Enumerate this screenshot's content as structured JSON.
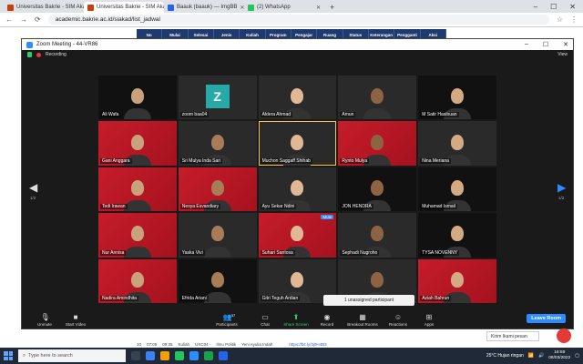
{
  "browser": {
    "tabs": [
      {
        "title": "Universitas Bakrie - SIM Akadem",
        "color": "#c2410c",
        "active": false
      },
      {
        "title": "Universitas Bakrie - SIM Akadem",
        "color": "#c2410c",
        "active": true
      },
      {
        "title": "Baauk (baauk) — ImgBB",
        "color": "#2563eb",
        "active": false
      },
      {
        "title": "(2) WhatsApp",
        "color": "#22c55e",
        "active": false
      }
    ],
    "new_tab": "+",
    "url": "academic.bakrie.ac.id/siakad/list_jadwal"
  },
  "page_table": {
    "headers": [
      "No",
      "Mulai",
      "Selesai",
      "Jenis",
      "Kuliah",
      "Program",
      "Pengajar",
      "Ruang",
      "Status",
      "Keterangan",
      "Pengganti",
      "Aksi"
    ],
    "bottom_row": [
      "10",
      "07:05",
      "09:35",
      "Kuliah",
      "UXC04 -",
      "Ilmu Politik",
      "Yeni Ayulia Indah",
      "",
      "",
      "https://bit.ly/3j0H4B3",
      "",
      ""
    ]
  },
  "zoom": {
    "title": "Zoom Meeting - 44-VR86",
    "recording_label": "Recording",
    "view_label": "View",
    "page_left": "1/2",
    "page_right": "1/2",
    "participants": [
      {
        "name": "Ali Wafa",
        "style": "dark"
      },
      {
        "name": "zoom baa04",
        "style": "zoom",
        "initial": "Z"
      },
      {
        "name": "Aldera Ahmad",
        "style": "gray"
      },
      {
        "name": "Amun",
        "style": "gray"
      },
      {
        "name": "M Satir Hasibuan",
        "style": "dark"
      },
      {
        "name": "Gani Anggara",
        "style": "red"
      },
      {
        "name": "Sri Mulya Inda Sari",
        "style": "gray"
      },
      {
        "name": "Muchon Saggaff Shihab",
        "style": "gray",
        "active": true
      },
      {
        "name": "Rynto Mulya",
        "style": "red"
      },
      {
        "name": "Nina Meriana",
        "style": "gray"
      },
      {
        "name": "Tedi Irawan",
        "style": "red"
      },
      {
        "name": "Nesya Esvandiary",
        "style": "red"
      },
      {
        "name": "Ayu Sekar Ndini",
        "style": "gray"
      },
      {
        "name": "JON HENDRA",
        "style": "dark"
      },
      {
        "name": "Muhamad Ismail",
        "style": "dark"
      },
      {
        "name": "Nur Annisa",
        "style": "red"
      },
      {
        "name": "Yaska Vivi",
        "style": "gray"
      },
      {
        "name": "Suhari Santosa",
        "style": "red",
        "mute": "Mute"
      },
      {
        "name": "Sephadi Nugroho",
        "style": "gray"
      },
      {
        "name": "TYSA NOVENNY",
        "style": "dark"
      },
      {
        "name": "Nadira Amindhita",
        "style": "red"
      },
      {
        "name": "Efrida Ariani",
        "style": "dark"
      },
      {
        "name": "Gitri Teguh Ardian",
        "style": "gray"
      },
      {
        "name": "",
        "style": "gray"
      },
      {
        "name": "Aziah Bahrun",
        "style": "red"
      }
    ],
    "unassigned": "1 unassigned participant",
    "toolbar": {
      "unmute": "Unmute",
      "start_video": "Start Video",
      "participants": "Participants",
      "participants_count": "37",
      "chat": "Chat",
      "share": "Share Screen",
      "record": "Record",
      "breakout": "Breakout Rooms",
      "reactions": "Reactions",
      "apps": "Apps",
      "leave": "Leave Room"
    }
  },
  "toast": "Kirim Ikami pesan",
  "taskbar": {
    "search_placeholder": "Type here to search",
    "weather": "25°C  Hujan ringan",
    "time": "18:59",
    "date": "08/03/2022"
  }
}
